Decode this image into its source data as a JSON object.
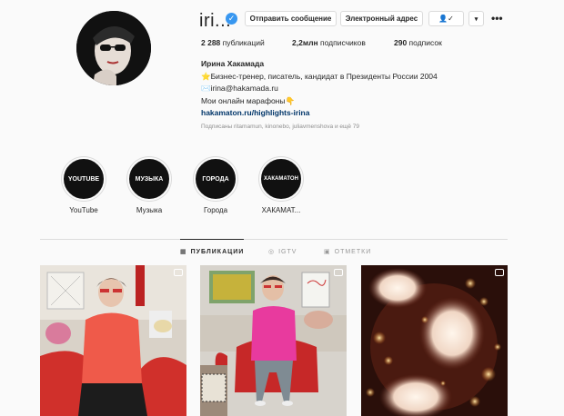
{
  "profile": {
    "username": "iri...",
    "verified_icon": "verified-badge-icon",
    "buttons": {
      "message": "Отправить сообщение",
      "email": "Электронный адрес",
      "follow_icon": "person-check-icon",
      "dropdown": "▾",
      "more": "•••"
    },
    "stats": {
      "posts_count": "2 288",
      "posts_label": " публикаций",
      "followers_count": "2,2млн",
      "followers_label": " подписчиков",
      "following_count": "290",
      "following_label": " подписок"
    },
    "bio": {
      "name": "Ирина Хакамада",
      "line1": "⭐Бизнес-тренер, писатель, кандидат в Президенты России 2004",
      "line2": "✉️irina@hakamada.ru",
      "line3": "Мои онлайн марафоны👇",
      "link": "hakamaton.ru/highlights-irina"
    },
    "followed_by": "Подписаны ritamamun, kinonebo, juliavmenshova и ещё 79"
  },
  "highlights": [
    {
      "cover": "YOUTUBE",
      "label": "YouTube"
    },
    {
      "cover": "МУЗЫКА",
      "label": "Музыка"
    },
    {
      "cover": "ГОРОДА",
      "label": "Города"
    },
    {
      "cover": "ХАКАМАТОН",
      "label": "ХАКАМАТ..."
    }
  ],
  "tabs": [
    {
      "label": "ПУБЛИКАЦИИ",
      "icon": "▦"
    },
    {
      "label": "IGTV",
      "icon": "◎"
    },
    {
      "label": "ОТМЕТКИ",
      "icon": "▣"
    }
  ],
  "colors": {
    "background": "#fafafa",
    "verified": "#3897f0",
    "link": "#003569",
    "muted": "#8e8e8e"
  }
}
